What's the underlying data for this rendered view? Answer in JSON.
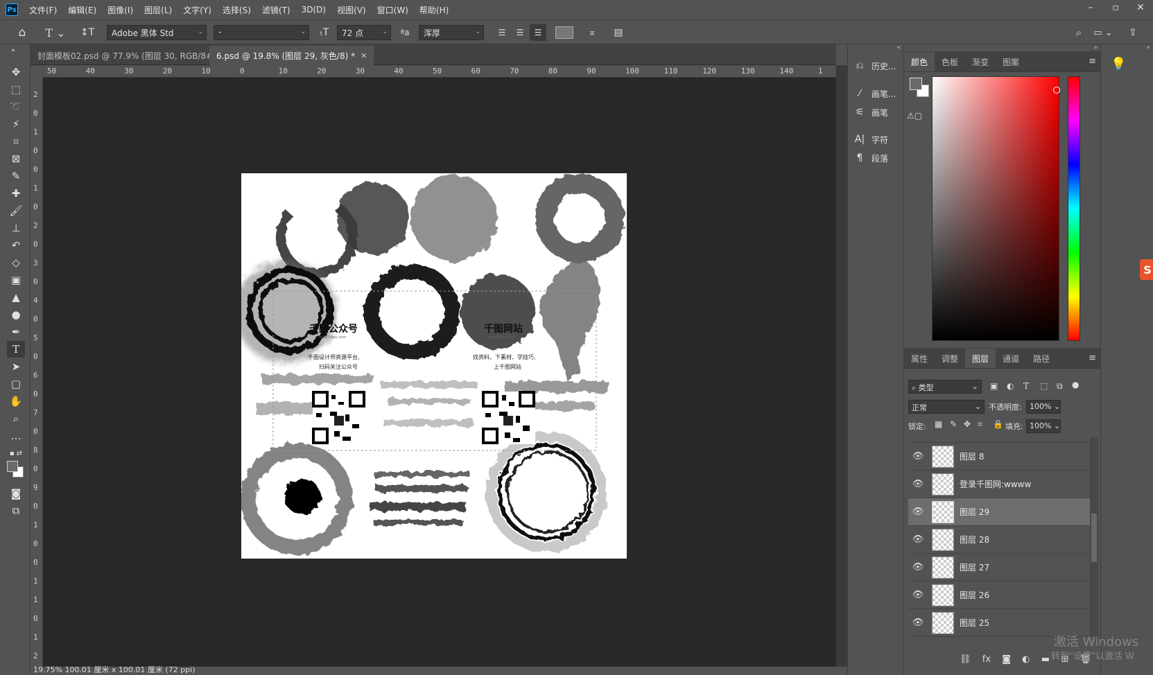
{
  "menu": [
    "文件(F)",
    "编辑(E)",
    "图像(I)",
    "图层(L)",
    "文字(Y)",
    "选择(S)",
    "滤镜(T)",
    "3D(D)",
    "视图(V)",
    "窗口(W)",
    "帮助(H)"
  ],
  "options": {
    "font_family": "Adobe 黑体 Std",
    "font_style": "-",
    "font_size": "72 点",
    "aa_label": "ªa",
    "antialias": "浑厚"
  },
  "tabs": [
    {
      "label": "封面模板02.psd @ 77.9% (图层 30, RGB/8#) *",
      "active": false
    },
    {
      "label": "6.psd @ 19.8% (图层 29, 灰色/8) *",
      "active": true
    }
  ],
  "ruler_h": [
    "50",
    "40",
    "30",
    "20",
    "10",
    "0",
    "10",
    "20",
    "30",
    "40",
    "50",
    "60",
    "70",
    "80",
    "90",
    "100",
    "110",
    "120",
    "130",
    "140",
    "1"
  ],
  "ruler_v": [
    "2",
    "0",
    "1",
    "0",
    "0",
    "1",
    "0",
    "2",
    "0",
    "3",
    "0",
    "4",
    "0",
    "5",
    "0",
    "6",
    "0",
    "7",
    "0",
    "8",
    "0",
    "9",
    "0",
    "1",
    "0",
    "0",
    "1",
    "1",
    "0",
    "1",
    "2"
  ],
  "canvas": {
    "left_title": "千图公众号",
    "left_sub1": "千图设计师资源平台,",
    "left_sub2": "扫码关注公众号",
    "right_title": "千图网站",
    "right_sub1": "找资料、下素材、学技巧,",
    "right_sub2": "上千图网站",
    "small_url_left": "www.58pic.com",
    "small_url_right": "www.58pic.com"
  },
  "status": "19.75%  100.01 厘米 x 100.01 厘米 (72 ppi)",
  "icon_panel": [
    "历史...",
    "画笔...",
    "画笔",
    "字符",
    "段落"
  ],
  "color_tabs": [
    "颜色",
    "色板",
    "渐变",
    "图案"
  ],
  "layer_tabs": [
    "属性",
    "调整",
    "图层",
    "通道",
    "路径"
  ],
  "layers_ui": {
    "filter": "类型",
    "blend": "正常",
    "opacity_label": "不透明度:",
    "opacity": "100%",
    "lock_label": "锁定:",
    "fill_label": "填充:",
    "fill": "100%"
  },
  "layers": [
    {
      "name": "图层 8",
      "selected": false
    },
    {
      "name": "登录千图网:wwww",
      "selected": false
    },
    {
      "name": "图层 29",
      "selected": true
    },
    {
      "name": "图层 28",
      "selected": false
    },
    {
      "name": "图层 27",
      "selected": false
    },
    {
      "name": "图层 26",
      "selected": false
    },
    {
      "name": "图层 25",
      "selected": false
    }
  ],
  "watermark": {
    "line1": "激活 Windows",
    "line2": "转到\"设置\"以激活 W"
  },
  "colors": {
    "accent": "#31a8ff",
    "canvas_bg": "#282828",
    "panel": "#535353"
  }
}
